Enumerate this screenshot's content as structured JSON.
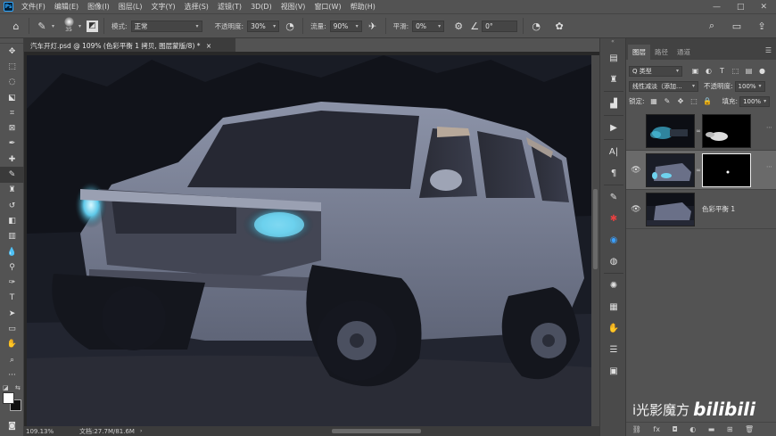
{
  "menubar": {
    "logo": "Ps",
    "items": [
      "文件(F)",
      "编辑(E)",
      "图像(I)",
      "图层(L)",
      "文字(Y)",
      "选择(S)",
      "滤镜(T)",
      "3D(D)",
      "视图(V)",
      "窗口(W)",
      "帮助(H)"
    ],
    "window_controls": [
      "—",
      "□",
      "✕"
    ]
  },
  "options": {
    "brush_size": "35",
    "mode_label": "模式:",
    "mode_value": "正常",
    "opacity_label": "不透明度:",
    "opacity_value": "30%",
    "flow_label": "流量:",
    "flow_value": "90%",
    "smoothing_label": "平滑:",
    "smoothing_value": "0%",
    "angle_value": "0°"
  },
  "document": {
    "tab_title": "汽车开灯.psd @ 109% (色彩平衡 1 拷贝, 图层蒙版/8) *",
    "tab_close": "×",
    "zoom": "109.13%",
    "doc_info": "文档:27.7M/81.6M"
  },
  "midbar_icons": [
    "history-icon",
    "clone-source-icon",
    "histogram-icon",
    "play-icon",
    "character-icon",
    "paragraph-icon",
    "brush-settings-icon",
    "swatches-icon",
    "color-icon",
    "styles-icon",
    "brightness-icon",
    "gradient-icon",
    "navigator-icon",
    "adjustments-icon",
    "libraries-icon"
  ],
  "layers_panel": {
    "tabs": [
      "图层",
      "路径",
      "通道"
    ],
    "filter_label": "Q 类型",
    "blend_mode": "线性减淡（添加...",
    "opacity_label": "不透明度:",
    "opacity_value": "100%",
    "lock_label": "锁定:",
    "fill_label": "填充:",
    "fill_value": "100%",
    "layers": [
      {
        "name": "",
        "visible": false,
        "has_mask": true,
        "selected": false
      },
      {
        "name": "",
        "visible": true,
        "has_mask": true,
        "selected": true
      },
      {
        "name": "色彩平衡 1",
        "visible": true,
        "has_mask": false,
        "selected": false
      }
    ]
  },
  "watermark": {
    "text": "i光影魔方",
    "logo": "bilibili"
  }
}
